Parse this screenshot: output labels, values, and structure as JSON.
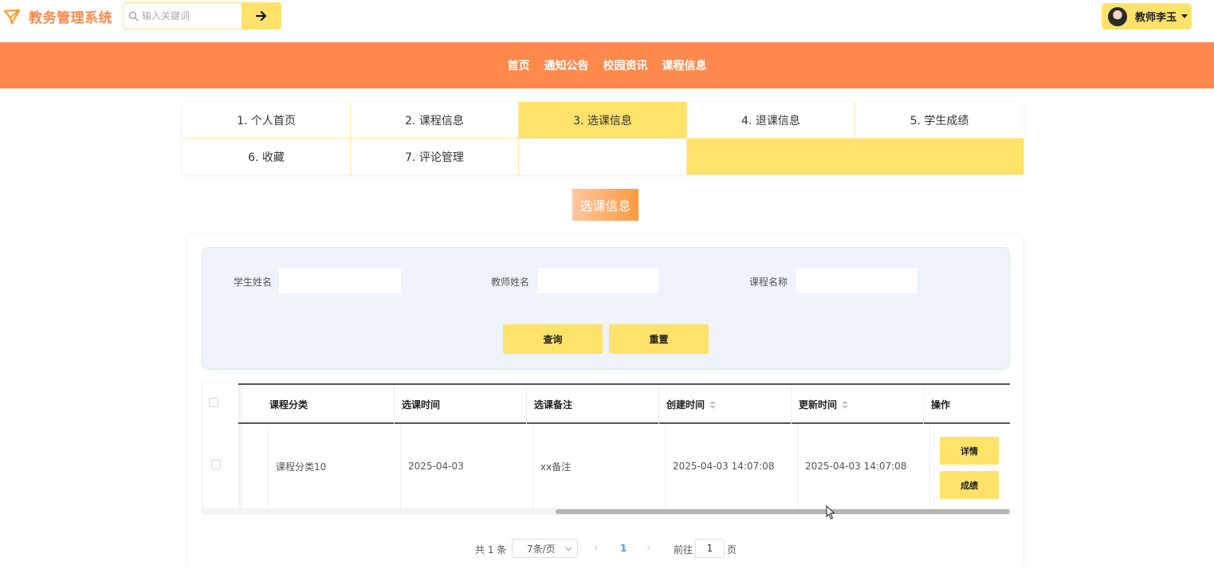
{
  "header": {
    "app_title": "教务管理系统",
    "search": {
      "placeholder": "输入关键词",
      "value": ""
    },
    "user": {
      "name": "教师李玉"
    }
  },
  "nav": {
    "items": [
      "首页",
      "通知公告",
      "校园资讯",
      "课程信息"
    ]
  },
  "tabs": {
    "items": [
      "1. 个人首页",
      "2. 课程信息",
      "3. 选课信息",
      "4. 退课信息",
      "5. 学生成绩",
      "6. 收藏",
      "7. 评论管理"
    ],
    "active_index": 2
  },
  "section_title": "选课信息",
  "filter": {
    "student_name_label": "学生姓名",
    "teacher_name_label": "教师姓名",
    "course_name_label": "课程名称",
    "student_name_value": "",
    "teacher_name_value": "",
    "course_name_value": "",
    "query_label": "查询",
    "reset_label": "重置"
  },
  "table": {
    "columns": [
      "课程分类",
      "选课时间",
      "选课备注",
      "创建时间",
      "更新时间",
      "操作"
    ],
    "rows": [
      {
        "category": "课程分类10",
        "select_time": "2025-04-03",
        "remark": "xx备注",
        "created": "2025-04-03 14:07:08",
        "updated": "2025-04-03 14:07:08",
        "detail_label": "详情",
        "score_label": "成绩"
      }
    ]
  },
  "pagination": {
    "total_text": "共 1 条",
    "page_size_text": "7条/页",
    "current_page": "1",
    "goto_label": "前往",
    "goto_value": "1",
    "page_suffix": "页"
  },
  "colors": {
    "accent_orange": "#ff894d",
    "accent_yellow": "#ffe26a",
    "filter_bg": "#eef3fc"
  }
}
